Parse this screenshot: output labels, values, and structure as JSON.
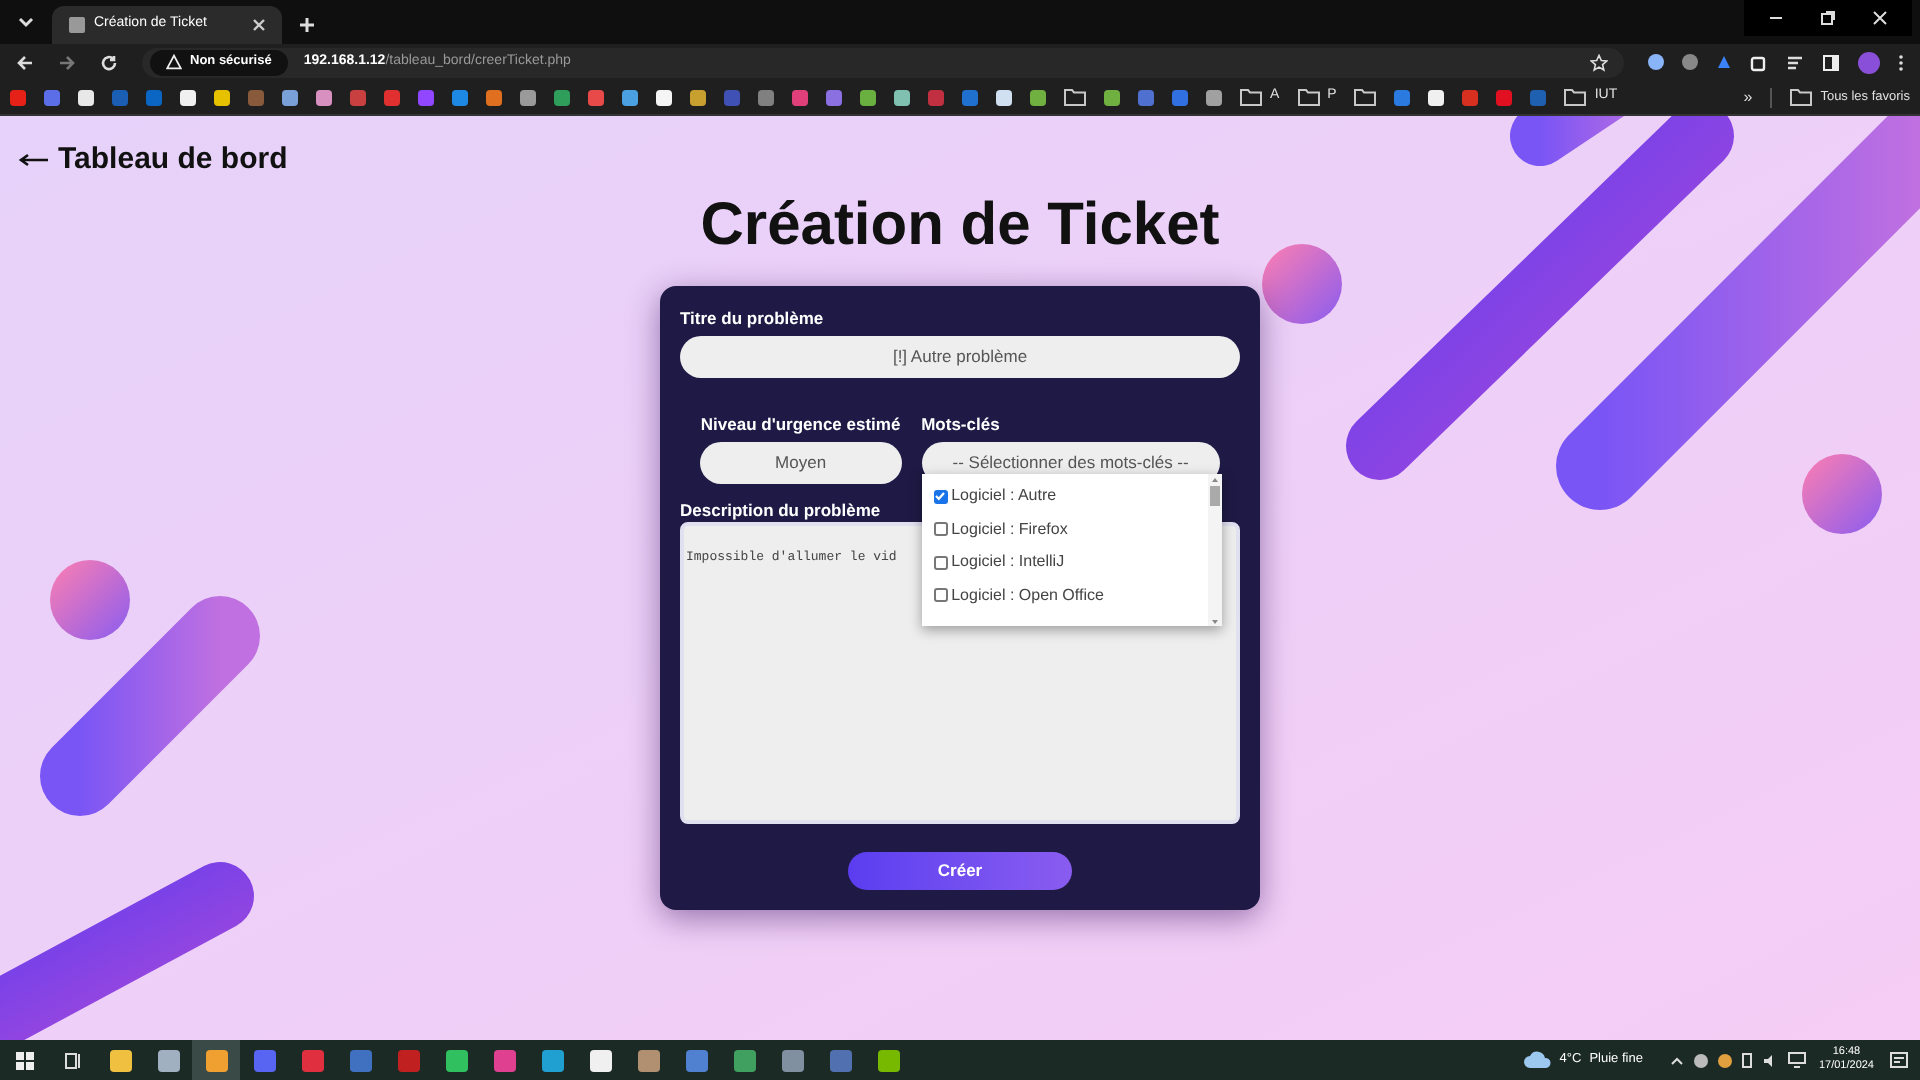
{
  "browser": {
    "tab": {
      "title": "Création de Ticket"
    },
    "address": {
      "security": "Non sécurisé",
      "host": "192.168.1.12",
      "path": "/tableau_bord/creerTicket.php"
    },
    "bookmarks": [
      {
        "kind": "favicon",
        "color": "#e62117"
      },
      {
        "kind": "favicon",
        "color": "#5b6ee8"
      },
      {
        "kind": "favicon",
        "color": "#e8e8e8"
      },
      {
        "kind": "favicon",
        "color": "#1a5fb4"
      },
      {
        "kind": "favicon",
        "color": "#0a66c2"
      },
      {
        "kind": "favicon",
        "color": "#f0f0f0"
      },
      {
        "kind": "favicon",
        "color": "#e5c100"
      },
      {
        "kind": "favicon",
        "color": "#8a5a3c"
      },
      {
        "kind": "favicon",
        "color": "#7aa0d8"
      },
      {
        "kind": "favicon",
        "color": "#d890c0"
      },
      {
        "kind": "favicon",
        "color": "#c84040"
      },
      {
        "kind": "favicon",
        "color": "#e03030"
      },
      {
        "kind": "favicon",
        "color": "#9146ff"
      },
      {
        "kind": "favicon",
        "color": "#1e88e5"
      },
      {
        "kind": "favicon",
        "color": "#e07020"
      },
      {
        "kind": "favicon",
        "color": "#9a9a9a"
      },
      {
        "kind": "favicon",
        "color": "#2e9e5a"
      },
      {
        "kind": "favicon",
        "color": "#e84a4a"
      },
      {
        "kind": "favicon",
        "color": "#4aa0e0"
      },
      {
        "kind": "favicon",
        "color": "#f5f5f5"
      },
      {
        "kind": "favicon",
        "color": "#c8a030"
      },
      {
        "kind": "favicon",
        "color": "#3f51b5"
      },
      {
        "kind": "favicon",
        "color": "#808080"
      },
      {
        "kind": "favicon",
        "color": "#e0407a"
      },
      {
        "kind": "favicon",
        "color": "#8a70e0"
      },
      {
        "kind": "favicon",
        "color": "#6ab040"
      },
      {
        "kind": "favicon",
        "color": "#80c0b0"
      },
      {
        "kind": "favicon",
        "color": "#c03040"
      },
      {
        "kind": "favicon",
        "color": "#2070d0"
      },
      {
        "kind": "favicon",
        "color": "#d0e0f0"
      },
      {
        "kind": "favicon",
        "color": "#70b040"
      },
      {
        "kind": "folder"
      },
      {
        "kind": "favicon",
        "color": "#70b040"
      },
      {
        "kind": "favicon",
        "color": "#5070d0"
      },
      {
        "kind": "favicon",
        "color": "#3070e0"
      },
      {
        "kind": "favicon",
        "color": "#a0a0a0"
      },
      {
        "kind": "folder",
        "label": "A"
      },
      {
        "kind": "folder",
        "label": "P"
      },
      {
        "kind": "folder"
      },
      {
        "kind": "favicon",
        "color": "#2a7ae0"
      },
      {
        "kind": "favicon",
        "color": "#f0f0f0"
      },
      {
        "kind": "favicon",
        "color": "#d83020"
      },
      {
        "kind": "favicon",
        "color": "#e01020"
      },
      {
        "kind": "favicon",
        "color": "#2060b0"
      },
      {
        "kind": "folder",
        "label": "IUT"
      }
    ],
    "overflow": "»",
    "all_bookmarks": "Tous les favoris"
  },
  "page": {
    "back_link": "Tableau de bord",
    "title": "Création de Ticket",
    "form": {
      "title_label": "Titre du problème",
      "title_value": "[!] Autre problème",
      "urgency_label": "Niveau d'urgence estimé",
      "urgency_value": "Moyen",
      "keywords_label": "Mots-clés",
      "keywords_placeholder": "-- Sélectionner des mots-clés --",
      "keywords_options": [
        {
          "label": "Logiciel : Autre",
          "checked": true
        },
        {
          "label": "Logiciel : Firefox",
          "checked": false
        },
        {
          "label": "Logiciel : IntelliJ",
          "checked": false
        },
        {
          "label": "Logiciel : Open Office",
          "checked": false
        }
      ],
      "description_label": "Description du problème",
      "description_value": "Impossible d'allumer le vid",
      "submit": "Créer"
    }
  },
  "taskbar": {
    "apps": [
      {
        "color": "#f0c040",
        "selected": false
      },
      {
        "color": "#a0b0c0",
        "selected": false
      },
      {
        "color": "#f0a030",
        "selected": true
      },
      {
        "color": "#5865f2",
        "selected": false
      },
      {
        "color": "#e03040",
        "selected": false
      },
      {
        "color": "#4070c0",
        "selected": false
      },
      {
        "color": "#c02020",
        "selected": false
      },
      {
        "color": "#30c060",
        "selected": false
      },
      {
        "color": "#e04090",
        "selected": false
      },
      {
        "color": "#20a0d0",
        "selected": false
      },
      {
        "color": "#f0f0f0",
        "selected": false
      },
      {
        "color": "#b09070",
        "selected": false
      },
      {
        "color": "#5080d0",
        "selected": false
      },
      {
        "color": "#40a060",
        "selected": false
      },
      {
        "color": "#8090a0",
        "selected": false
      },
      {
        "color": "#5070b0",
        "selected": false
      },
      {
        "color": "#76b900",
        "selected": false
      }
    ],
    "temperature": "4°C",
    "weather": "Pluie fine",
    "time": "16:48",
    "date": "17/01/2024"
  }
}
